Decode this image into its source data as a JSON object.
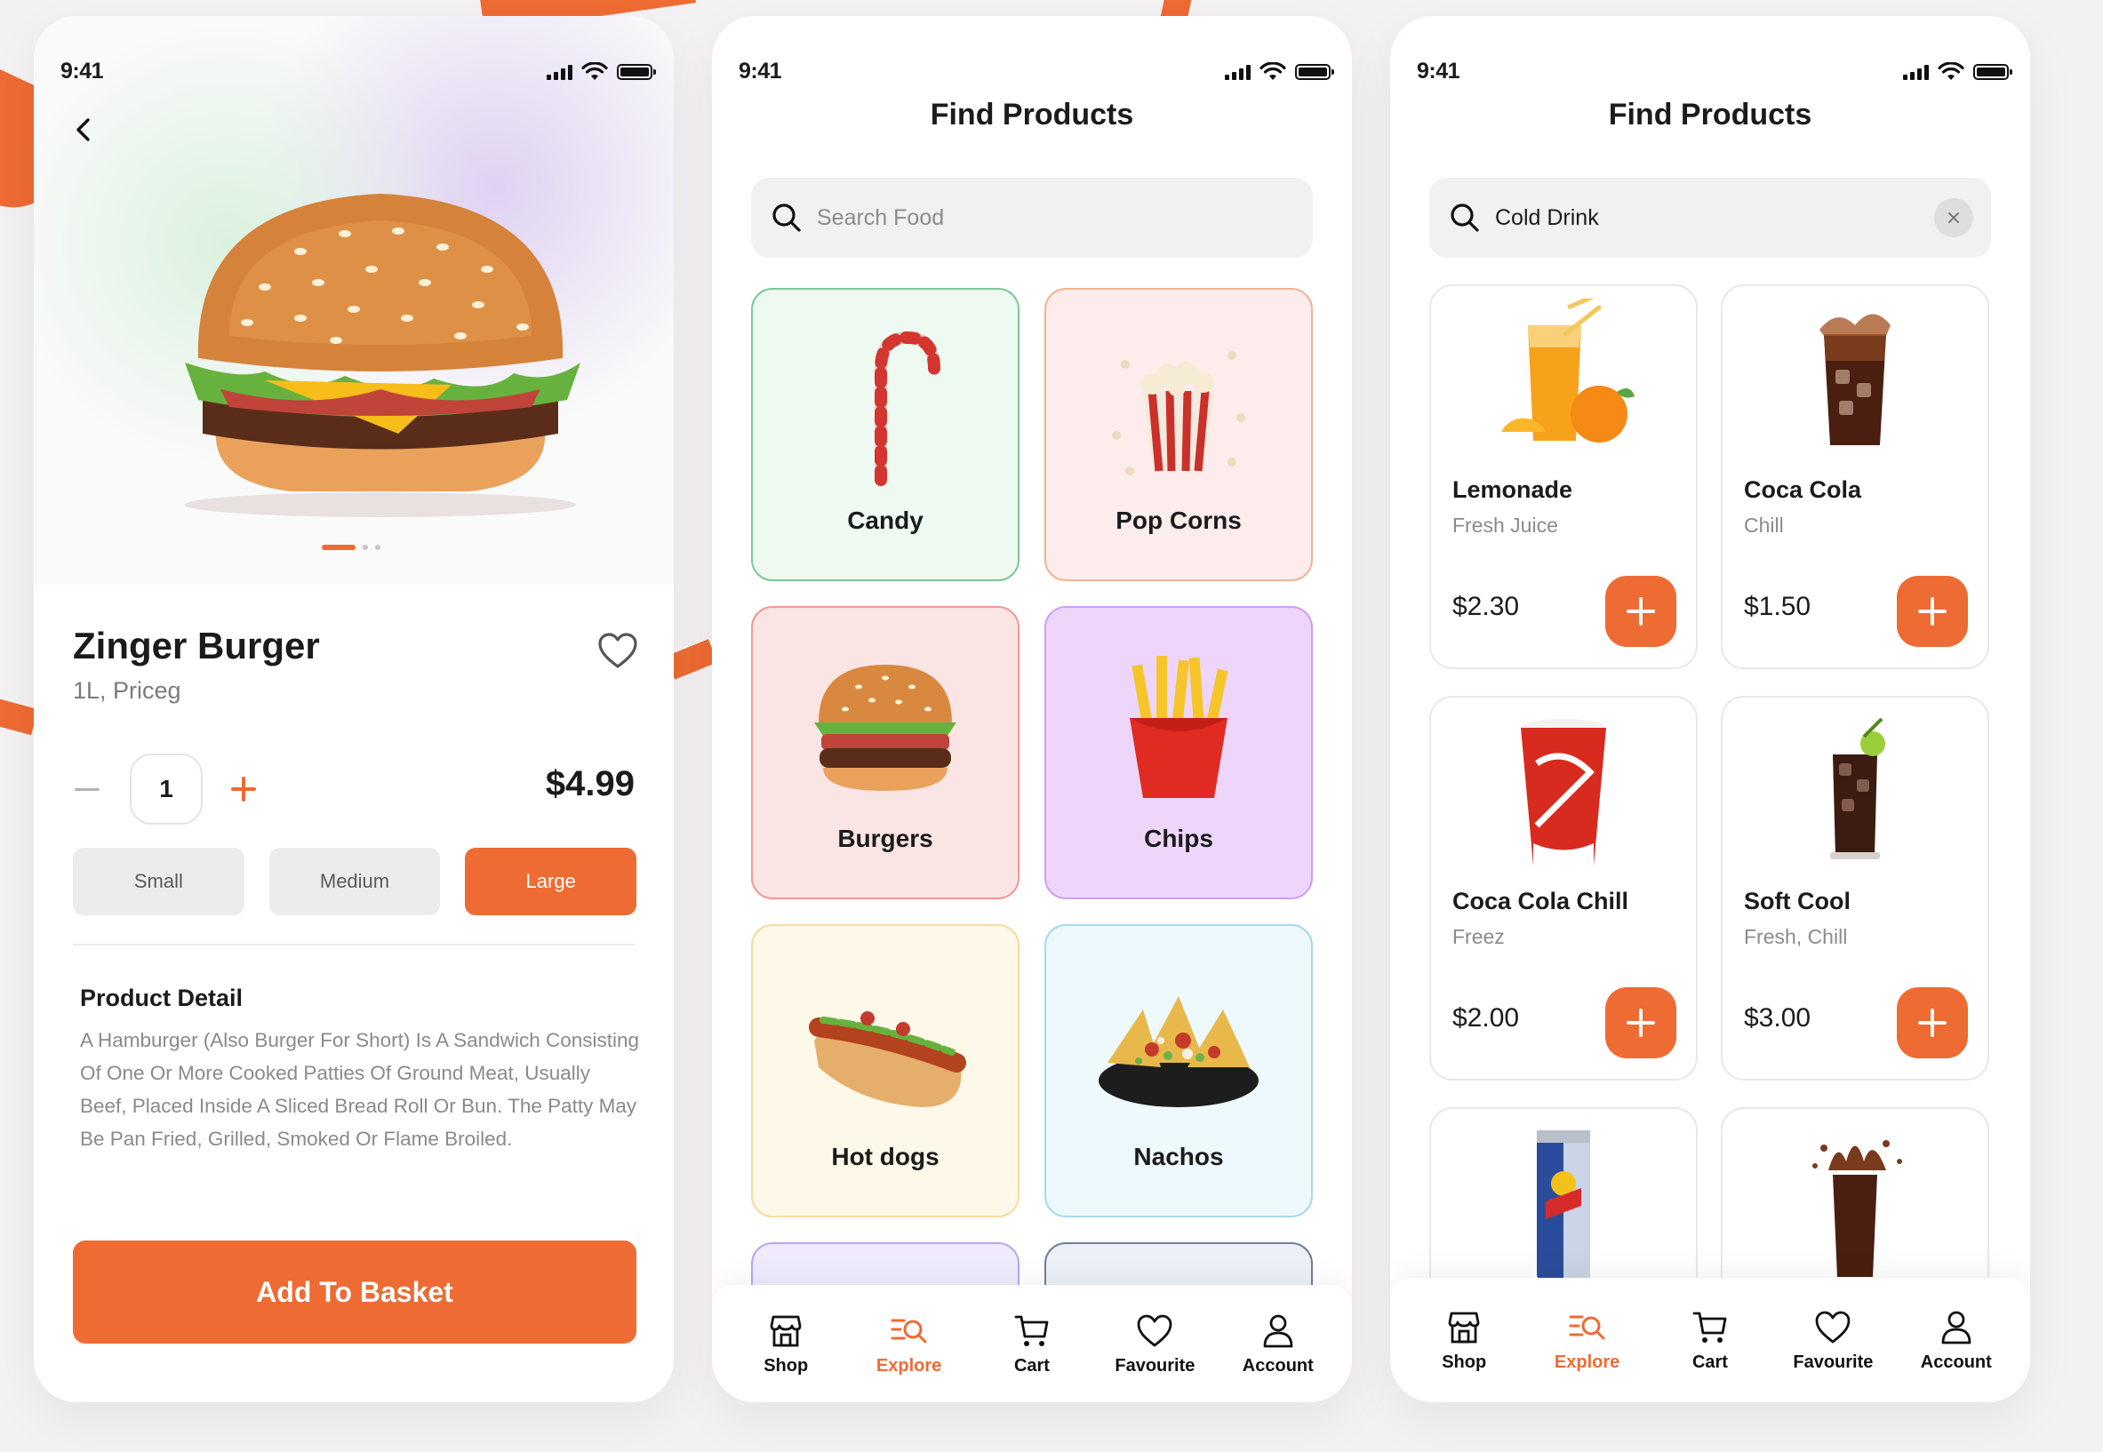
{
  "status": {
    "time": "9:41"
  },
  "detail": {
    "title": "Zinger Burger",
    "subtitle": "1L, Priceg",
    "quantity": "1",
    "price": "$4.99",
    "sizes": [
      "Small",
      "Medium",
      "Large"
    ],
    "selected_size": "Large",
    "section_title": "Product Detail",
    "description": "A Hamburger (Also Burger For Short) Is A Sandwich Consisting Of One Or More Cooked Patties Of Ground Meat, Usually Beef, Placed Inside A Sliced Bread Roll Or Bun. The Patty May Be Pan Fried, Grilled, Smoked Or Flame Broiled.",
    "cta": "Add To Basket"
  },
  "explore": {
    "title": "Find Products",
    "search_placeholder": "Search Food",
    "categories": [
      {
        "label": "Candy",
        "bg": "#eefaf1",
        "border": "#79c995",
        "icon": "candy-cane-icon"
      },
      {
        "label": "Pop Corns",
        "bg": "#fdecec",
        "border": "#f3b38f",
        "icon": "popcorn-icon"
      },
      {
        "label": "Burgers",
        "bg": "#fbe5e4",
        "border": "#ef9a93",
        "icon": "burger-icon"
      },
      {
        "label": "Chips",
        "bg": "#eed6fb",
        "border": "#cf9ff0",
        "icon": "fries-icon"
      },
      {
        "label": "Hot dogs",
        "bg": "#fef8e8",
        "border": "#f6dc9c",
        "icon": "hotdog-icon"
      },
      {
        "label": "Nachos",
        "bg": "#eef9fd",
        "border": "#a8d9ec",
        "icon": "nachos-icon"
      }
    ],
    "more_categories": [
      {
        "bg": "#f0ebfc",
        "border": "#b7a7e8"
      },
      {
        "bg": "#ecf0f7",
        "border": "#6f7f98"
      }
    ]
  },
  "results": {
    "title": "Find Products",
    "search_value": "Cold Drink",
    "products": [
      {
        "name": "Lemonade",
        "sub": "Fresh Juice",
        "price": "$2.30",
        "icon": "orange-juice-icon"
      },
      {
        "name": "Coca Cola",
        "sub": "Chill",
        "price": "$1.50",
        "icon": "cola-glass-icon"
      },
      {
        "name": "Coca Cola Chill",
        "sub": "Freez",
        "price": "$2.00",
        "icon": "cola-cup-icon"
      },
      {
        "name": "Soft Cool",
        "sub": "Fresh, Chill",
        "price": "$3.00",
        "icon": "iced-soda-icon"
      },
      {
        "name": "",
        "sub": "",
        "price": "",
        "icon": "energy-drink-can-icon"
      },
      {
        "name": "",
        "sub": "",
        "price": "",
        "icon": "cola-splash-icon"
      }
    ]
  },
  "nav": {
    "items": [
      "Shop",
      "Explore",
      "Cart",
      "Favourite",
      "Account"
    ],
    "active": "Explore"
  },
  "colors": {
    "accent": "#ee6b33",
    "text": "#1b1b1b",
    "muted": "#8b8b8b"
  }
}
